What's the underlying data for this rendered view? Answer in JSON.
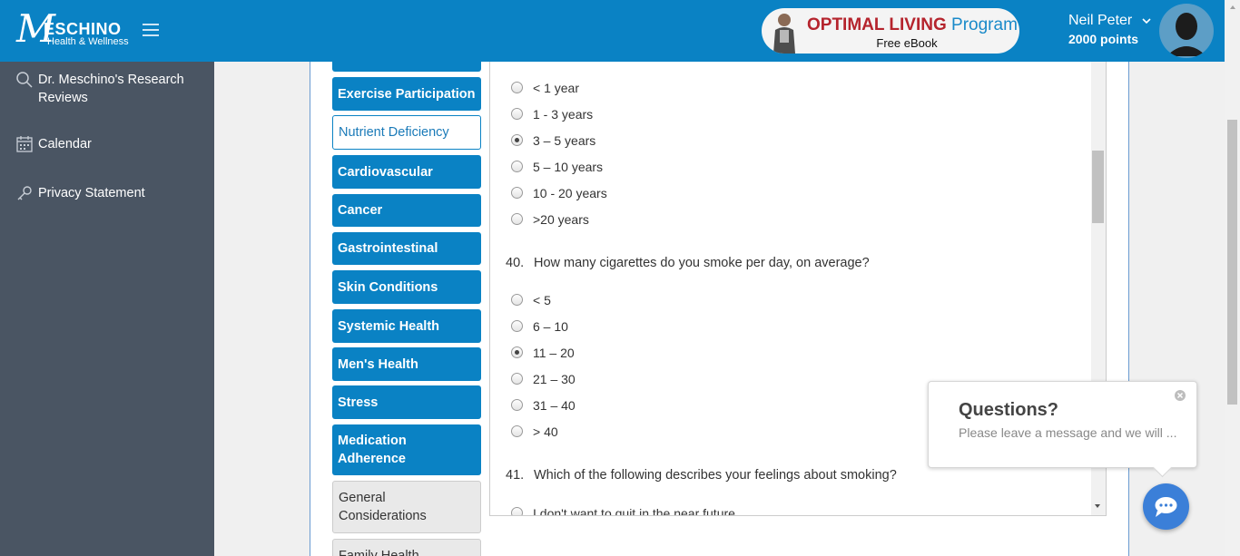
{
  "header": {
    "logo_mark": "M",
    "logo_text": "ESCHINO",
    "logo_sub": "Health & Wellness",
    "promo_title": "OPTIMAL LIVING",
    "promo_program": "Program",
    "promo_sub": "Free eBook",
    "user_name": "Neil Peter",
    "user_points": "2000 points"
  },
  "sidebar": {
    "items": [
      {
        "label": "Dr. Meschino's Research Reviews",
        "icon": "search-icon"
      },
      {
        "label": "Calendar",
        "icon": "calendar-icon"
      },
      {
        "label": "Privacy Statement",
        "icon": "key-icon"
      }
    ]
  },
  "categories": [
    {
      "label": "Exercise Participation"
    },
    {
      "label": "Nutrient Deficiency"
    },
    {
      "label": "Cardiovascular"
    },
    {
      "label": "Cancer"
    },
    {
      "label": "Gastrointestinal"
    },
    {
      "label": "Skin Conditions"
    },
    {
      "label": "Systemic Health"
    },
    {
      "label": "Men's Health"
    },
    {
      "label": "Stress"
    },
    {
      "label": "Medication Adherence"
    },
    {
      "label": "General Considerations"
    },
    {
      "label": "Family Health"
    }
  ],
  "q39": {
    "options": [
      "< 1 year",
      "1 - 3 years",
      "3 – 5 years",
      "5 – 10 years",
      "10 - 20 years",
      ">20 years"
    ],
    "selected": "3 – 5 years"
  },
  "q40": {
    "num": "40.",
    "text": "How many cigarettes do you smoke per day, on average?",
    "options": [
      "< 5",
      "6 – 10",
      "11 – 20",
      "21 – 30",
      "31 – 40",
      "> 40"
    ],
    "selected": "11 – 20"
  },
  "q41": {
    "num": "41.",
    "text": "Which of the following describes your feelings about smoking?",
    "options": [
      "I don't want to quit in the near future"
    ]
  },
  "chat": {
    "title": "Questions?",
    "message": "Please leave a message and we will ..."
  },
  "colors": {
    "brand_blue": "#0a82c4",
    "sidebar_bg": "#4a5563",
    "promo_red": "#b5242d",
    "chat_blue": "#3b7fd8"
  }
}
